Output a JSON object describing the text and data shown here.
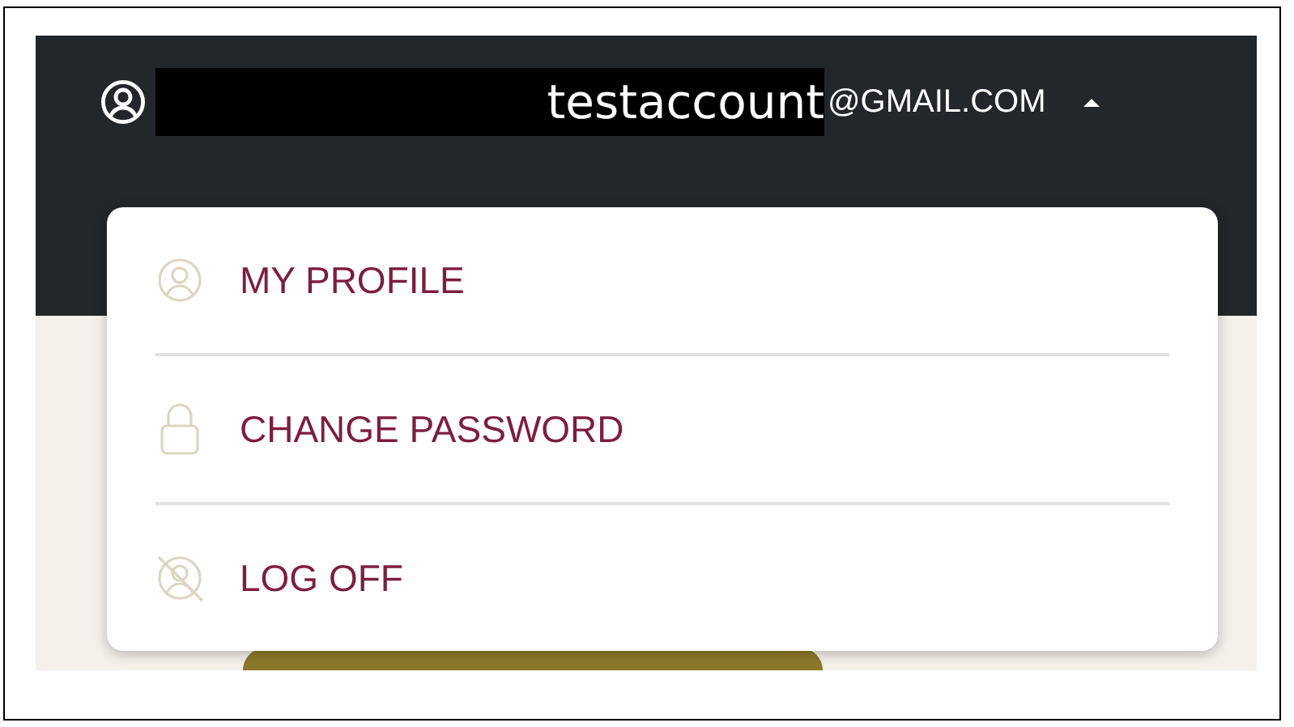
{
  "header": {
    "user_name": "testaccount",
    "email_domain": "@GMAIL.COM",
    "menu_expanded": true
  },
  "menu": [
    {
      "kind": "profile",
      "label": "MY PROFILE"
    },
    {
      "kind": "password",
      "label": "CHANGE PASSWORD"
    },
    {
      "kind": "logoff",
      "label": "LOG OFF"
    }
  ]
}
